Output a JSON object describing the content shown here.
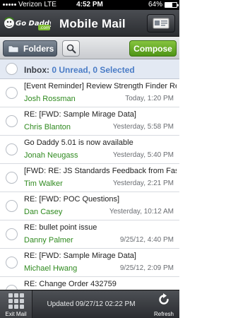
{
  "status_bar": {
    "carrier": "Verizon",
    "network": "LTE",
    "time": "4:52 PM",
    "battery": "64%",
    "battery_level": 0.64
  },
  "header": {
    "logo_text": "Go Daddy",
    "logo_suffix": ".com",
    "title": "Mobile Mail",
    "compose_icon": "card-icon"
  },
  "toolbar": {
    "folders_label": "Folders",
    "folder_icon": "folder-icon",
    "search_icon": "search-icon",
    "compose_label": "Compose"
  },
  "inbox": {
    "label": "Inbox:",
    "status": "0 Unread, 0 Selected"
  },
  "messages": [
    {
      "subject": "[Event Reminder] Review Strength Finder Results",
      "sender": "Josh Rossman",
      "date": "Today, 1:20 PM"
    },
    {
      "subject": "RE: [FWD: Sample Mirage Data]",
      "sender": "Chris Blanton",
      "date": "Yesterday, 5:58 PM"
    },
    {
      "subject": "Go Daddy 5.01 is now available",
      "sender": "Jonah Neugass",
      "date": "Yesterday, 5:40 PM"
    },
    {
      "subject": "[FWD: RE: JS Standards Feedback from Fastb…",
      "sender": "Tim Walker",
      "date": "Yesterday, 2:21 PM"
    },
    {
      "subject": "RE: [FWD: POC Questions]",
      "sender": "Dan Casey",
      "date": "Yesterday, 10:12 AM"
    },
    {
      "subject": "RE: bullet point issue",
      "sender": "Danny Palmer",
      "date": "9/25/12, 4:40 PM"
    },
    {
      "subject": "RE: [FWD: Sample Mirage Data]",
      "sender": "Michael Hwang",
      "date": "9/25/12, 2:09 PM"
    },
    {
      "subject": "RE: Change Order 432759",
      "sender": "",
      "date": ""
    }
  ],
  "bottom_bar": {
    "exit_label": "Exit Mail",
    "updated_text": "Updated 09/27/12 02:22 PM",
    "refresh_label": "Refresh"
  },
  "colors": {
    "accent_blue": "#4a7cc6",
    "sender_green": "#2f8a1f",
    "compose_green": "#5fa62a",
    "header_dark": "#2b2d31"
  }
}
